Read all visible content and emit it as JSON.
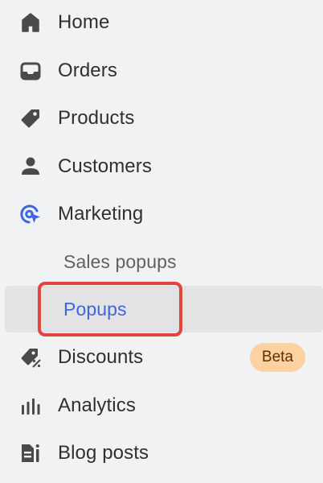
{
  "nav": {
    "items": [
      {
        "label": "Home",
        "icon": "home-icon"
      },
      {
        "label": "Orders",
        "icon": "inbox-icon"
      },
      {
        "label": "Products",
        "icon": "tag-icon"
      },
      {
        "label": "Customers",
        "icon": "person-icon"
      },
      {
        "label": "Marketing",
        "icon": "target-icon",
        "icon_color": "#3e67df"
      },
      {
        "label": "Discounts",
        "icon": "discount-tag-icon",
        "badge": "Beta"
      },
      {
        "label": "Analytics",
        "icon": "bar-chart-icon"
      },
      {
        "label": "Blog posts",
        "icon": "blog-icon"
      }
    ],
    "marketing_subitems": [
      {
        "label": "Sales popups",
        "state": "default"
      },
      {
        "label": "Popups",
        "state": "selected"
      }
    ]
  },
  "colors": {
    "background": "#f1f2f4",
    "text": "#303030",
    "muted_text": "#616161",
    "selected_text": "#3e67df",
    "selected_row": "#e3e3e5",
    "highlight_border": "#e5433f",
    "badge_bg": "#fdd2a0"
  }
}
